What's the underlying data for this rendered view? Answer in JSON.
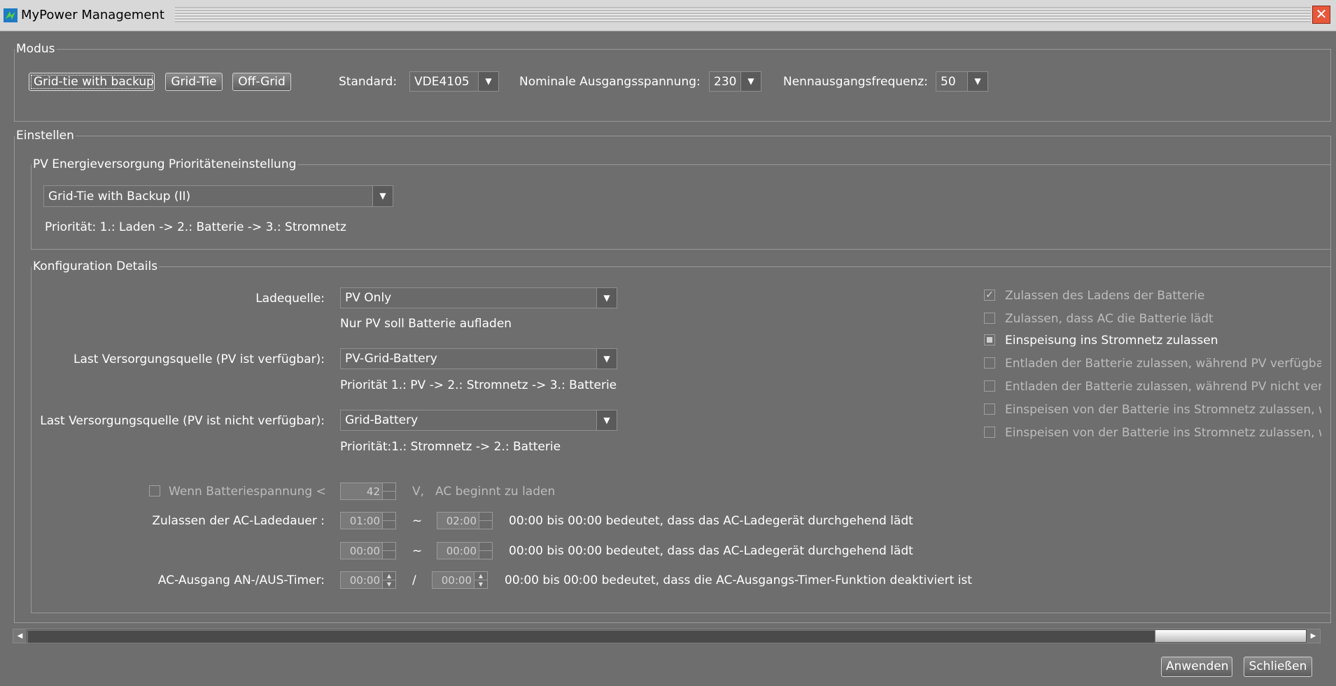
{
  "window": {
    "title": "MyPower Management"
  },
  "modus": {
    "legend": "Modus",
    "buttons": [
      "Grid-tie with backup",
      "Grid-Tie",
      "Off-Grid"
    ],
    "standard_label": "Standard:",
    "standard_value": "VDE4105",
    "voltage_label": "Nominale Ausgangsspannung:",
    "voltage_value": "230",
    "freq_label": "Nennausgangsfrequenz:",
    "freq_value": "50"
  },
  "einstellen": {
    "legend": "Einstellen",
    "pv": {
      "legend": "PV Energieversorgung Prioritäteneinstellung",
      "select_value": "Grid-Tie with Backup (II)",
      "priority_text": "Priorität: 1.: Laden -> 2.: Batterie -> 3.: Stromnetz"
    },
    "config": {
      "legend": "Konfiguration Details",
      "ladequelle_label": "Ladequelle:",
      "ladequelle_value": "PV Only",
      "ladequelle_hint": "Nur PV soll Batterie aufladen",
      "last_pv_label": "Last Versorgungsquelle (PV ist verfügbar):",
      "last_pv_value": "PV-Grid-Battery",
      "last_pv_hint": "Priorität 1.: PV -> 2.: Stromnetz -> 3.: Batterie",
      "last_nopv_label": "Last Versorgungsquelle (PV ist nicht verfügbar):",
      "last_nopv_value": "Grid-Battery",
      "last_nopv_hint": "Priorität:1.: Stromnetz -> 2.: Batterie",
      "battery_check_label": "Wenn Batteriespannung <",
      "battery_value": "42",
      "battery_unit": "V,",
      "battery_hint": "AC beginnt zu laden",
      "ac_duration_label": "Zulassen der AC-Ladedauer :",
      "dur1_from": "01:00",
      "dur1_to": "02:00",
      "dur2_from": "00:00",
      "dur2_to": "00:00",
      "tilde": "~",
      "dur_hint": "00:00 bis 00:00 bedeutet, dass das AC-Ladegerät durchgehend lädt",
      "timer_label": "AC-Ausgang AN-/AUS-Timer:",
      "timer_from": "00:00",
      "timer_slash": "/",
      "timer_to": "00:00",
      "timer_hint": "00:00 bis 00:00 bedeutet, dass die AC-Ausgangs-Timer-Funktion deaktiviert ist",
      "checkboxes": [
        "Zulassen des Ladens der Batterie",
        "Zulassen, dass AC die Batterie lädt",
        "Einspeisung ins Stromnetz zulassen",
        "Entladen der Batterie zulassen, während PV verfügbar",
        "Entladen der Batterie zulassen, während PV nicht verfü",
        "Einspeisen von der Batterie ins Stromnetz zulassen, w",
        "Einspeisen von der Batterie ins Stromnetz zulassen, w"
      ]
    }
  },
  "footer": {
    "apply": "Anwenden",
    "close": "Schließen"
  }
}
